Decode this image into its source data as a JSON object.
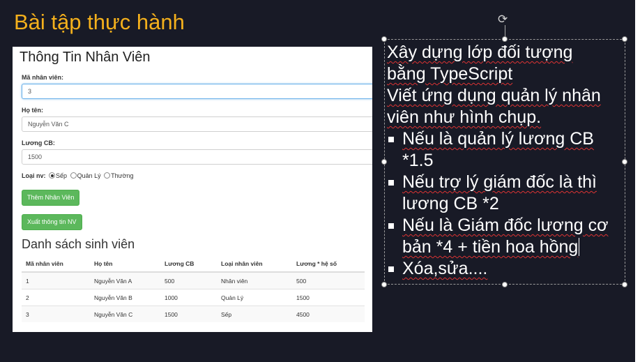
{
  "slide": {
    "title": "Bài tập thực hành",
    "colors": {
      "background": "#181a26",
      "title": "#f4b01c",
      "text": "#ffffff",
      "button": "#5cb85c"
    }
  },
  "screenshot": {
    "form": {
      "heading": "Thông Tin Nhân Viên",
      "id_label": "Mã nhân viên:",
      "id_value": "3",
      "name_label": "Họ tên:",
      "name_value": "Nguyễn Văn C",
      "salary_label": "Lương CB:",
      "salary_value": "1500",
      "type_label": "Loại nv:",
      "type_options": [
        "Sếp",
        "Quản Lý",
        "Thường"
      ],
      "type_selected": "Sếp",
      "add_button": "Thêm Nhân Viên",
      "export_button": "Xuất thông tin NV"
    },
    "list": {
      "heading": "Danh sách sinh viên",
      "columns": [
        "Mã nhân viên",
        "Họ tên",
        "Lương CB",
        "Loại nhân viên",
        "Lương * hệ số"
      ],
      "rows": [
        [
          "1",
          "Nguyễn Văn A",
          "500",
          "Nhân viên",
          "500"
        ],
        [
          "2",
          "Nguyễn Văn B",
          "1000",
          "Quản Lý",
          "1500"
        ],
        [
          "3",
          "Nguyễn Văn C",
          "1500",
          "Sếp",
          "4500"
        ]
      ]
    }
  },
  "textbox": {
    "p1a": "Xây dựng lớp đối tượng",
    "p1b": "bằng TypeScript",
    "p2a": "Viết ứng dụng quản lý nhân",
    "p2b": "viên như hình chụp.",
    "b1a": "Nếu là quản lý lương CB",
    "b1b": "*1.5",
    "b2a": "Nếu trợ lý giám đốc là thì",
    "b2b": "lương CB *2",
    "b3a": "Nếu là Giám đốc lương cơ",
    "b3b": "bản *4 + tiền hoa hồng",
    "b4": "Xóa,sửa...."
  }
}
